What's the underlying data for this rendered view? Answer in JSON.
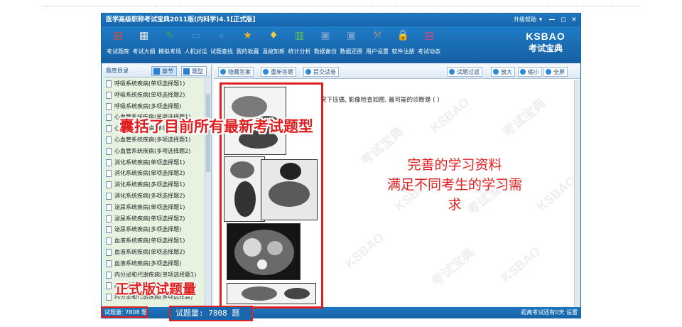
{
  "window": {
    "title": "医学高级职称考试宝典2011版(内科学)4.1[正式版]",
    "help": "升级帮助",
    "controls": [
      "▾",
      "—",
      "◻",
      "✕"
    ]
  },
  "toolbar": {
    "items": [
      {
        "label": "考试题库",
        "icon": "book-icon",
        "color": "#d84a3a",
        "glyph": "▤"
      },
      {
        "label": "考试大纲",
        "icon": "document-icon",
        "color": "#e8e8e8",
        "glyph": "▦"
      },
      {
        "label": "模拟考场",
        "icon": "pencil-icon",
        "color": "#3aa84a",
        "glyph": "✎"
      },
      {
        "label": "人机对话",
        "icon": "monitor-icon",
        "color": "#5a8ad8",
        "glyph": "▭"
      },
      {
        "label": "试题查找",
        "icon": "search-icon",
        "color": "#4aa0e0",
        "glyph": "⌕"
      },
      {
        "label": "我的收藏",
        "icon": "star-icon",
        "color": "#f0b020",
        "glyph": "★"
      },
      {
        "label": "温故知新",
        "icon": "bulb-icon",
        "color": "#f4d040",
        "glyph": "♦"
      },
      {
        "label": "统计分析",
        "icon": "chart-icon",
        "color": "#6ac04a",
        "glyph": "▥"
      },
      {
        "label": "数据备份",
        "icon": "backup-icon",
        "color": "#7aa0d0",
        "glyph": "▣"
      },
      {
        "label": "数据还原",
        "icon": "restore-icon",
        "color": "#7aa0d0",
        "glyph": "▣"
      },
      {
        "label": "用户设置",
        "icon": "tools-icon",
        "color": "#8a8a8a",
        "glyph": "⚒"
      },
      {
        "label": "软件注册",
        "icon": "lock-icon",
        "color": "#f0c020",
        "glyph": "🔒"
      },
      {
        "label": "考试动态",
        "icon": "news-icon",
        "color": "#d84a7a",
        "glyph": "▤"
      }
    ],
    "logo_en": "KSBAO",
    "logo_cn": "考试宝典"
  },
  "left": {
    "heading": "题库目录",
    "tab_chapter": "章节",
    "tab_type": "题型",
    "items": [
      "呼吸系统疾病(单项选择题1)",
      "呼吸系统疾病(单项选择题2)",
      "呼吸系统疾病(多项选择题)",
      "心血管系统疾病(单项选择题1)",
      "心血管系统疾病(单项选择题2)",
      "心血管系统疾病(多项选择题1)",
      "心血管系统疾病(多项选择题2)",
      "消化系统疾病(单项选择题1)",
      "消化系统疾病(单项选择题2)",
      "消化系统疾病(多项选择题1)",
      "消化系统疾病(多项选择题2)",
      "泌尿系统疾病(单项选择题1)",
      "泌尿系统疾病(单项选择题2)",
      "泌尿系统疾病(多项选择题)",
      "血液系统疾病(单项选择题1)",
      "血液系统疾病(单项选择题2)",
      "血液系统疾病(多项选择题)",
      "内分泌和代谢疾病(单项选择题1)",
      "内分泌和代谢疾病(单项选择题2)",
      "内分泌和代谢疾病(多项选择题)"
    ]
  },
  "right": {
    "buttons_left": [
      "隐藏答案",
      "重新答题",
      "提交试卷"
    ],
    "buttons_right": [
      "试题过滤",
      "放大",
      "缩小",
      "全屏"
    ],
    "question": "24. 男, 55岁, 中上腹隐痛多年, 剑突下压痛, 影像检查如图, 最可能的诊断是  (     )",
    "watermark_en": "KSBAO",
    "watermark_cn": "考试宝典"
  },
  "status": {
    "left": "试题量: 7808 题",
    "right": "距离考试还有0天  设置"
  },
  "overlays": {
    "banner_top": "囊括了目前所有最新考试题型",
    "caption_line1": "完善的学习资料",
    "caption_line2": "满足不同考生的学习需求",
    "banner_bottom": "正式版试题量",
    "count_box": "试题量: 7808 题"
  },
  "colors": {
    "accent_red": "#e02020",
    "window_blue": "#1b6aa8"
  }
}
